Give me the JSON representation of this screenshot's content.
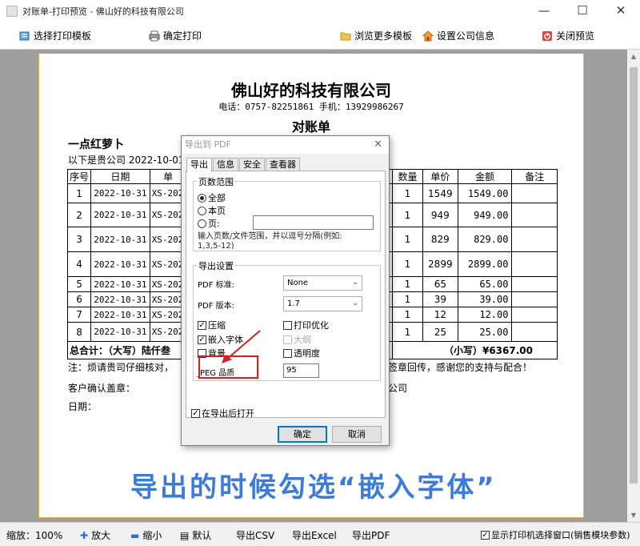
{
  "window": {
    "title": "对账单-打印预览 - 佛山好的科技有限公司",
    "controls": [
      "—",
      "☐",
      "✕"
    ]
  },
  "toolbar": {
    "select_template": "选择打印模板",
    "confirm_print": "确定打印",
    "browse_templates": "浏览更多模板",
    "company_settings": "设置公司信息",
    "close_preview": "关闭预览"
  },
  "document": {
    "company": "佛山好的科技有限公司",
    "contact": "电话：0757-82251861 手机：13929986267",
    "title": "对账单",
    "customer": "一点红萝卜",
    "intro": "以下是贵公司 2022-10-01",
    "columns": [
      "序号",
      "日期",
      "单",
      "数量",
      "单价",
      "金额",
      "备注"
    ],
    "rows": [
      {
        "idx": "1",
        "date": "2022-10-31",
        "no": "XS-202",
        "qty": "1",
        "price": "1549",
        "amount": "1549.00"
      },
      {
        "idx": "2",
        "date": "2022-10-31",
        "no": "XS-202",
        "qty": "1",
        "price": "949",
        "amount": "949.00"
      },
      {
        "idx": "3",
        "date": "2022-10-31",
        "no": "XS-202",
        "qty": "1",
        "price": "829",
        "amount": "829.00"
      },
      {
        "idx": "4",
        "date": "2022-10-31",
        "no": "XS-202",
        "qty": "1",
        "price": "2899",
        "amount": "2899.00"
      },
      {
        "idx": "5",
        "date": "2022-10-31",
        "no": "XS-202",
        "qty": "1",
        "price": "65",
        "amount": "65.00"
      },
      {
        "idx": "6",
        "date": "2022-10-31",
        "no": "XS-202",
        "qty": "1",
        "price": "39",
        "amount": "39.00"
      },
      {
        "idx": "7",
        "date": "2022-10-31",
        "no": "XS-202",
        "qty": "1",
        "price": "12",
        "amount": "12.00"
      },
      {
        "idx": "8",
        "date": "2022-10-31",
        "no": "XS-202",
        "qty": "1",
        "price": "25",
        "amount": "25.00"
      }
    ],
    "total_label": "总合计：（大写）陆仟叁",
    "total_value": "（小写）¥6367.00",
    "note_left": "注：烦请贵司仔细核对，",
    "note_right": "签章回传，感谢您的支持与配合！",
    "confirm_stamp": "客户确认盖章：",
    "company_suffix": "公司",
    "date_label": "日期：",
    "caption": "导出的时候勾选“嵌入字体”"
  },
  "dialog": {
    "title": "导出到 PDF",
    "close": "✕",
    "tabs": [
      "导出",
      "信息",
      "安全",
      "查看器"
    ],
    "page_range_label": "页数范围",
    "radio_all": "全部",
    "radio_current": "本页",
    "radio_pages": "页:",
    "pages_value": "",
    "hint_line1": "输入页数/文件范围，并以逗号分隔(例如:",
    "hint_line2": "1,3,5-12)",
    "export_settings_label": "导出设置",
    "pdf_standard_label": "PDF 标准:",
    "pdf_standard_value": "None",
    "pdf_version_label": "PDF 版本:",
    "pdf_version_value": "1.7",
    "compress": "压缩",
    "print_optimize": "打印优化",
    "embed_fonts": "嵌入字体",
    "outline": "大纲",
    "background": "背景",
    "transparency": "透明度",
    "jpeg_quality_label": "JPEG 品质",
    "jpeg_quality_value": "95",
    "open_after_export": "在导出后打开",
    "ok": "确定",
    "cancel": "取消"
  },
  "statusbar": {
    "zoom": "缩放：100%",
    "zoom_in": "放大",
    "zoom_out": "缩小",
    "default": "默认",
    "export_csv": "导出CSV",
    "export_excel": "导出Excel",
    "export_pdf": "导出PDF",
    "show_printer": "显示打印机选择窗口(销售模块参数)"
  },
  "colors": {
    "caption": "#3b7be0",
    "highlight": "#e01c1c",
    "paper_border": "#e8b14a",
    "preview_bg": "#9e9e9e"
  }
}
